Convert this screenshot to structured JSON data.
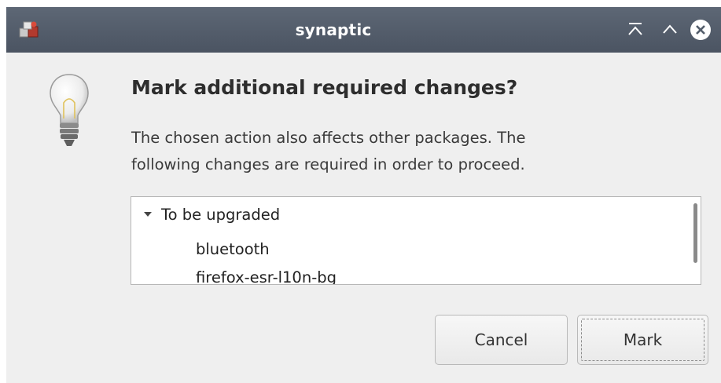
{
  "window": {
    "title": "synaptic",
    "titlebar_color": "#545e6c"
  },
  "icons": {
    "app": "synaptic-package-icon",
    "keep_above": "keep-above-icon",
    "maximize": "maximize-icon",
    "close": "close-icon",
    "dialog": "lightbulb-icon",
    "expander": "expander-down-icon"
  },
  "dialog": {
    "heading": "Mark additional required changes?",
    "message_line1": "The chosen action also affects other packages. The",
    "message_line2": "following changes are required in order to proceed."
  },
  "changes": {
    "group_label": "To be upgraded",
    "expanded": true,
    "items": [
      "bluetooth",
      "firefox-esr-l10n-bg"
    ]
  },
  "buttons": {
    "cancel_label": "Cancel",
    "mark_label": "Mark"
  }
}
